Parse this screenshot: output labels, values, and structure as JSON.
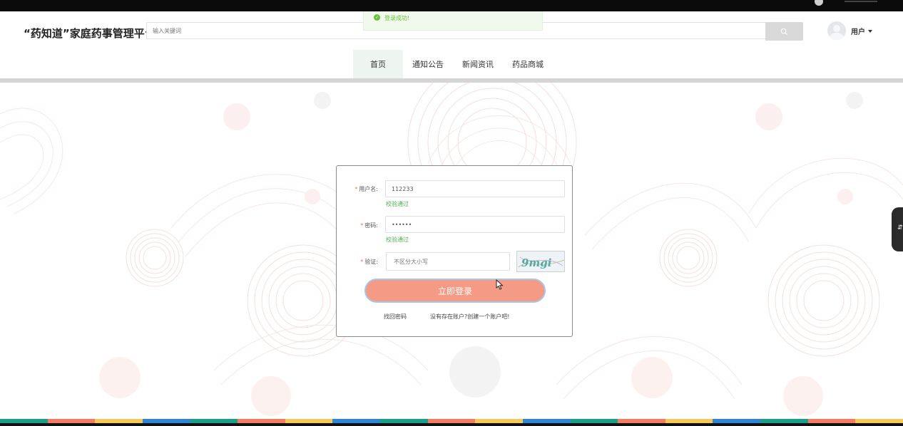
{
  "app": {
    "brand_title": "“药知道”家庭药事管理平台"
  },
  "search": {
    "placeholder": "输入关键词"
  },
  "user": {
    "name": "用户"
  },
  "toast": {
    "message": "登录成功!"
  },
  "nav": {
    "items": [
      {
        "label": "首页",
        "bar_color": "#1a9f8a",
        "active": true
      },
      {
        "label": "通知公告",
        "bar_color": "#f47d61",
        "active": false
      },
      {
        "label": "新闻资讯",
        "bar_color": "#f7c85a",
        "active": false
      },
      {
        "label": "药品商城",
        "bar_color": "#2f86d4",
        "active": false
      }
    ]
  },
  "login": {
    "username_label": "用户名:",
    "username_value": "112233",
    "username_hint": "校验通过",
    "password_label": "密码:",
    "password_value": "••••••",
    "password_hint": "校验通过",
    "captcha_label": "验证:",
    "captcha_placeholder": "不区分大小写",
    "captcha_text": "9mgi",
    "submit_label": "立即登录",
    "forgot_link": "找回密码",
    "register_link": "没有存在账户?创建一个账户吧!"
  },
  "side_tab": {
    "label": "⇵"
  },
  "icons": {
    "search": "search-icon",
    "success": "check-circle-icon",
    "avatar": "user-avatar-icon",
    "dropdown": "chevron-down-icon",
    "cursor": "mouse-cursor-icon"
  },
  "colors": {
    "accent_teal": "#1a9f8a",
    "accent_coral": "#f47d61",
    "accent_yellow": "#f7c85a",
    "accent_blue": "#2f86d4",
    "login_button": "#f59b85",
    "success_green": "#67c23a"
  },
  "bottom_stripe_colors": [
    "#1a9f8a",
    "#f47d61",
    "#f7c85a",
    "#2f86d4"
  ]
}
